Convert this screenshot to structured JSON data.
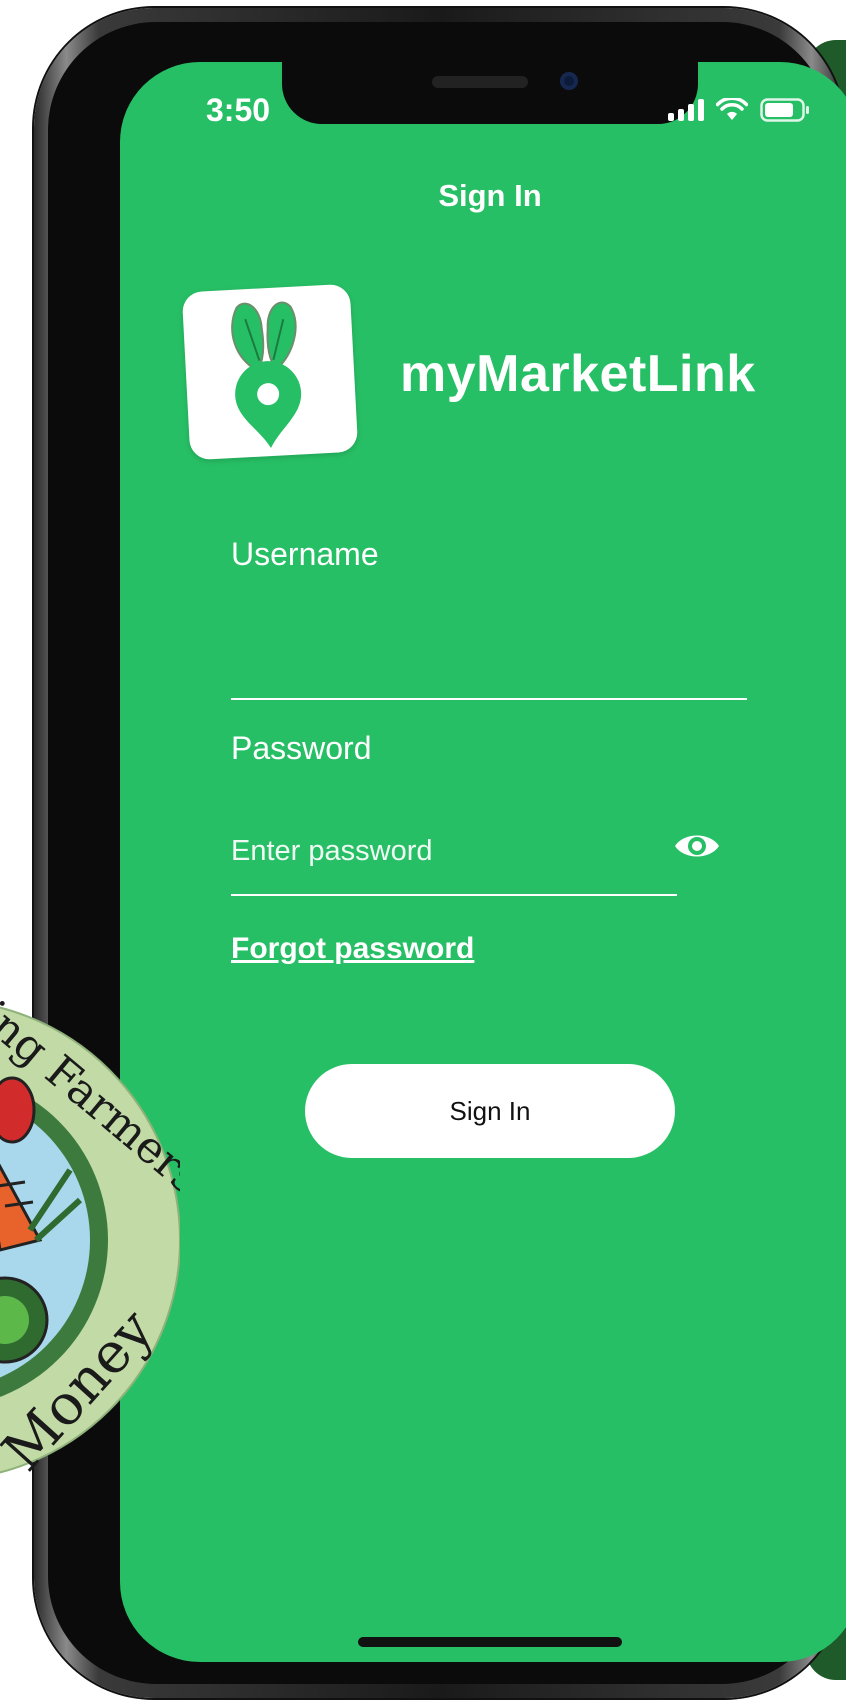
{
  "status_bar": {
    "time": "3:50"
  },
  "header": {
    "title": "Sign In"
  },
  "brand": {
    "name": "myMarketLink",
    "logo_icon": "beet-location-pin-icon"
  },
  "form": {
    "username_label": "Username",
    "username_value": "",
    "password_label": "Password",
    "password_placeholder": "Enter password",
    "show_password_icon": "eye-icon",
    "forgot_password": "Forgot password",
    "submit_label": "Sign In"
  },
  "badge": {
    "text_top": "ting Farmers",
    "text_bottom": "Money"
  },
  "colors": {
    "screen_background": "#27bf65",
    "badge_outer": "#c2dba6",
    "badge_ring": "#3c7a3d",
    "badge_center": "#a9d8ec"
  }
}
